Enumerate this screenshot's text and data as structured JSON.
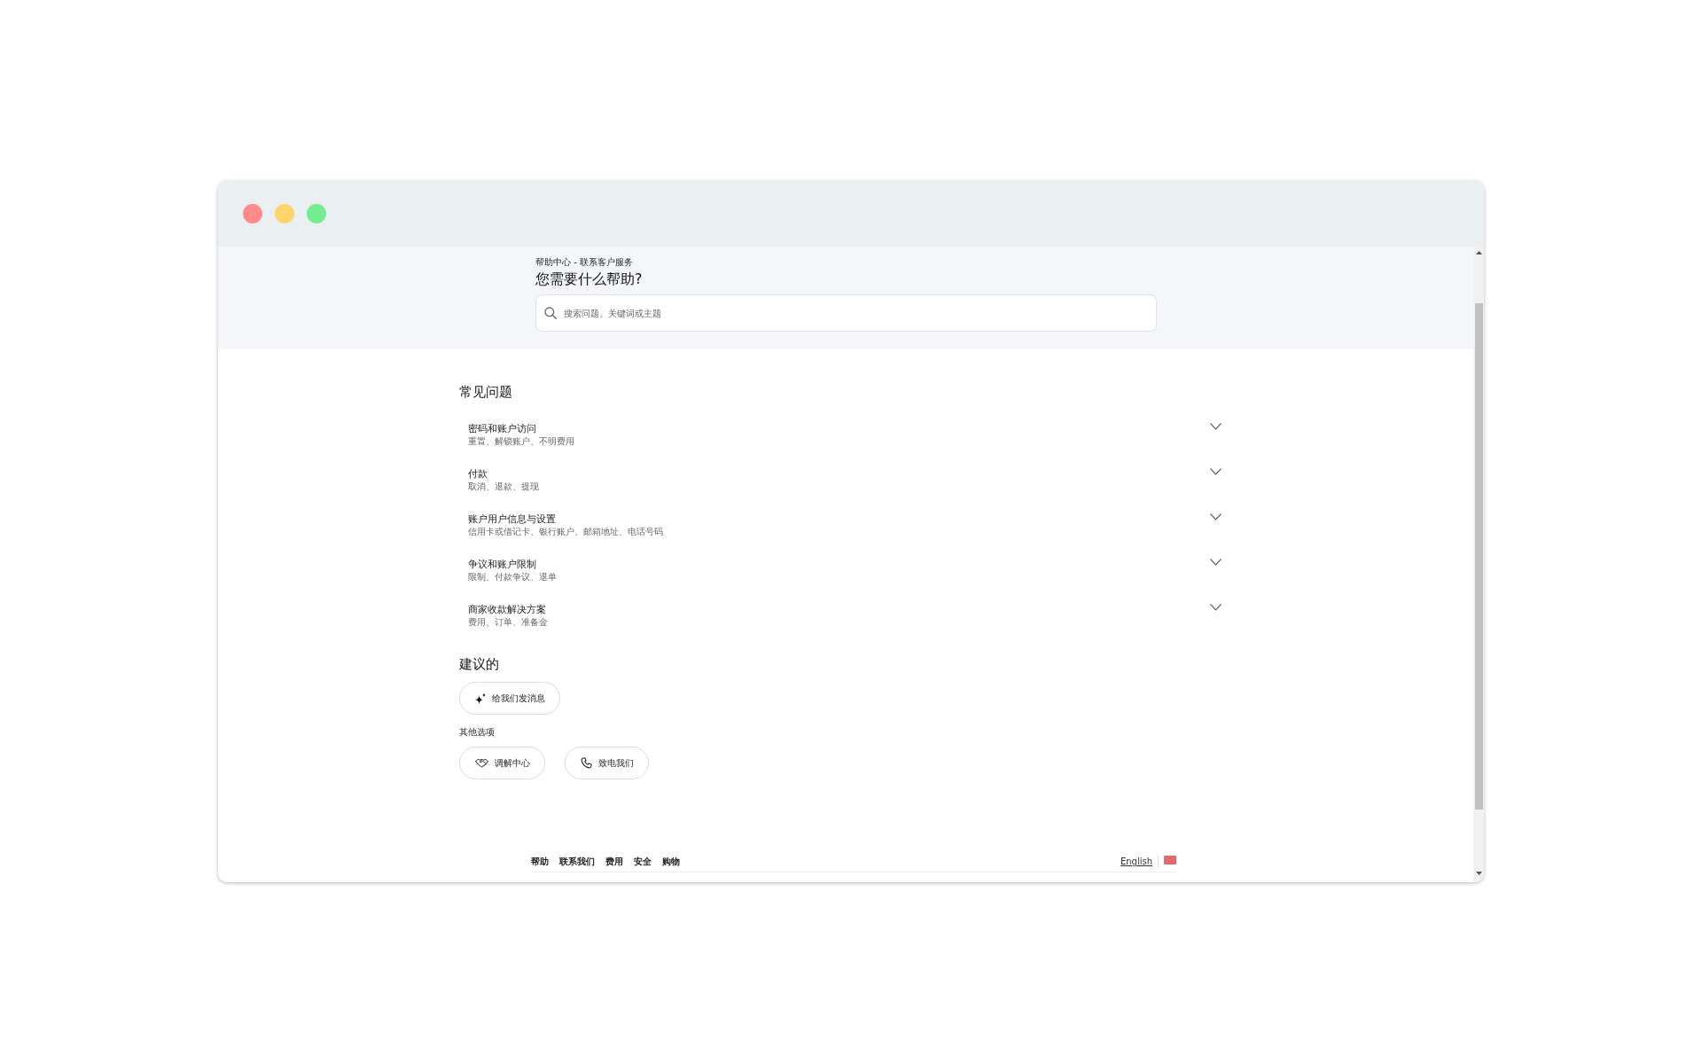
{
  "header": {
    "breadcrumb": "帮助中心 - 联系客户服务",
    "title": "您需要什么帮助?",
    "search": {
      "placeholder": "搜索问题、关键词或主题"
    }
  },
  "faq": {
    "title": "常见问题",
    "items": [
      {
        "title": "密码和账户访问",
        "subtitle": "重置、解锁账户、不明费用",
        "expanded": false
      },
      {
        "title": "付款",
        "subtitle": "取消、退款、提现",
        "expanded": false
      },
      {
        "title": "账户用户信息与设置",
        "subtitle": "信用卡或借记卡、银行账户、邮箱地址、电话号码",
        "expanded": false
      },
      {
        "title": "争议和账户限制",
        "subtitle": "限制、付款争议、退单",
        "expanded": false
      },
      {
        "title": "商家收款解决方案",
        "subtitle": "费用、订单、准备金",
        "expanded": false
      }
    ]
  },
  "suggested": {
    "title": "建议的",
    "buttons": [
      {
        "kind": "message",
        "label": "给我们发消息"
      }
    ]
  },
  "other_options": {
    "title": "其他选项",
    "buttons": [
      {
        "kind": "mediation",
        "label": "调解中心"
      },
      {
        "kind": "call",
        "label": "致电我们"
      }
    ]
  },
  "footer": {
    "links": [
      "帮助",
      "联系我们",
      "费用",
      "安全",
      "购物"
    ],
    "language": "English"
  }
}
